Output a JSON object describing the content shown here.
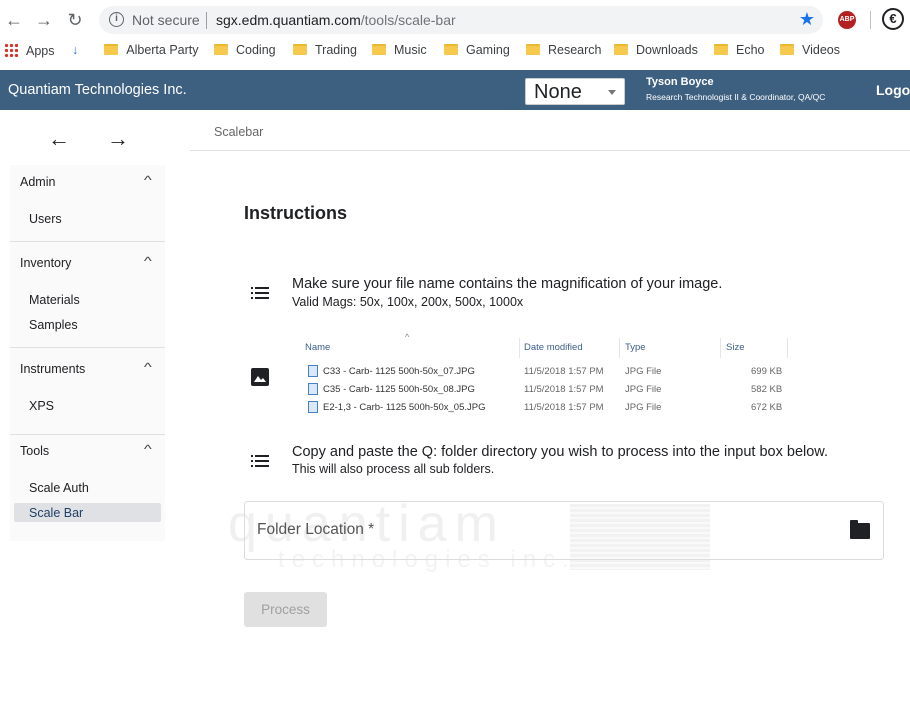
{
  "browser": {
    "security_label": "Not secure",
    "url_host": "sgx.edm.quantiam.com",
    "url_path": "/tools/scale-bar",
    "extension_abp": "ABP",
    "back_glyph": "←",
    "forward_glyph": "→",
    "reload_glyph": "↻",
    "star_glyph": "★",
    "info_glyph": "i",
    "extension_e": "€",
    "download_glyph": "↓"
  },
  "bookmarks": {
    "items": [
      {
        "label": "Apps",
        "icon": "apps-grid-icon"
      },
      {
        "label": "Alberta Party",
        "icon": "download-icon"
      },
      {
        "label": "Coding",
        "icon": "folder-icon"
      },
      {
        "label": "Trading",
        "icon": "folder-icon"
      },
      {
        "label": "Music",
        "icon": "folder-icon"
      },
      {
        "label": "Gaming",
        "icon": "folder-icon"
      },
      {
        "label": "Research",
        "icon": "folder-icon"
      },
      {
        "label": "Downloads",
        "icon": "folder-icon"
      },
      {
        "label": "Echo",
        "icon": "folder-icon"
      },
      {
        "label": "Videos",
        "icon": "folder-icon"
      }
    ]
  },
  "header": {
    "title": "Quantiam Technologies Inc.",
    "select_value": "None",
    "user_name": "Tyson Boyce",
    "user_role": "Research Technologist II & Coordinator, QA/QC",
    "logout_label": "Logo"
  },
  "nav": {
    "back_glyph": "←",
    "forward_glyph": "→"
  },
  "sidebar": {
    "chevron_glyph": "^",
    "sections": [
      {
        "title": "Admin",
        "items": [
          "Users"
        ]
      },
      {
        "title": "Inventory",
        "items": [
          "Materials",
          "Samples"
        ]
      },
      {
        "title": "Instruments",
        "items": [
          "XPS"
        ]
      },
      {
        "title": "Tools",
        "items": [
          "Scale Auth",
          "Scale Bar"
        ]
      }
    ],
    "active_item": "Scale Bar"
  },
  "main": {
    "breadcrumb": "Scalebar",
    "heading": "Instructions",
    "step1": {
      "text": "Make sure your file name contains the magnification of your image.",
      "sub": "Valid Mags: 50x, 100x, 200x, 500x, 1000x"
    },
    "explorer": {
      "sort_glyph": "^",
      "columns": [
        "Name",
        "Date modified",
        "Type",
        "Size"
      ],
      "rows": [
        {
          "name": "C33 - Carb- 1125  500h-50x_07.JPG",
          "date": "11/5/2018 1:57 PM",
          "type": "JPG File",
          "size": "699 KB"
        },
        {
          "name": "C35 - Carb- 1125  500h-50x_08.JPG",
          "date": "11/5/2018 1:57 PM",
          "type": "JPG File",
          "size": "582 KB"
        },
        {
          "name": "E2-1,3 - Carb- 1125  500h-50x_05.JPG",
          "date": "11/5/2018 1:57 PM",
          "type": "JPG File",
          "size": "672 KB"
        }
      ]
    },
    "step2": {
      "text": "Copy and paste the Q: folder directory you wish to process into the input box below.",
      "sub": "This will also process all sub folders."
    },
    "folder_field": {
      "label": "Folder Location *",
      "value": ""
    },
    "watermark": {
      "line1": "quantiam",
      "line2": "technologies inc."
    },
    "process_label": "Process"
  }
}
